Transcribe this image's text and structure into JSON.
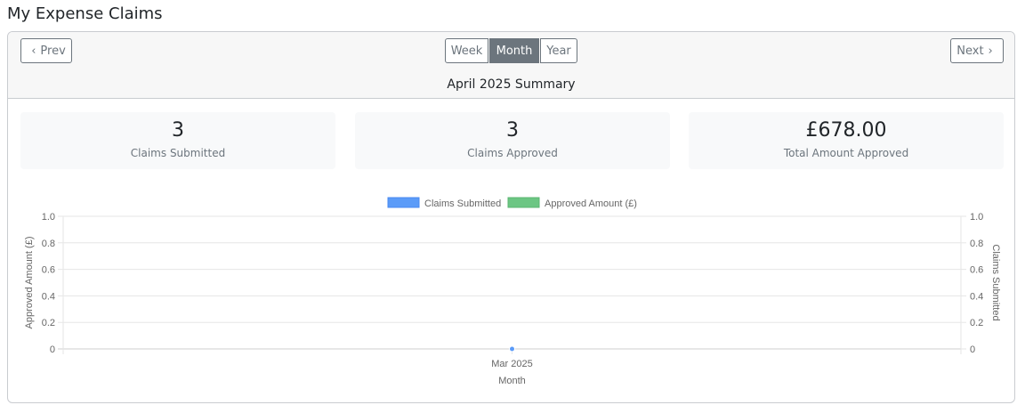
{
  "page": {
    "title": "My Expense Claims"
  },
  "nav": {
    "prev_label": "Prev",
    "next_label": "Next",
    "ranges": [
      "Week",
      "Month",
      "Year"
    ],
    "selected_range": "Month"
  },
  "summary": {
    "title": "April 2025 Summary",
    "stats": [
      {
        "value": "3",
        "label": "Claims Submitted"
      },
      {
        "value": "3",
        "label": "Claims Approved"
      },
      {
        "value": "£678.00",
        "label": "Total Amount Approved"
      }
    ]
  },
  "colors": {
    "claims_submitted": "#5b9bf8",
    "approved_amount": "#6cc683",
    "active_button": "#6c757d"
  },
  "chart_data": {
    "type": "line",
    "x": [
      "Mar 2025"
    ],
    "xlabel": "Month",
    "series": [
      {
        "name": "Claims Submitted",
        "values": [
          0
        ],
        "axis": "right",
        "color": "#5b9bf8"
      },
      {
        "name": "Approved Amount (£)",
        "values": [
          0
        ],
        "axis": "left",
        "color": "#6cc683"
      }
    ],
    "y_left": {
      "label": "Approved Amount (£)",
      "ylim": [
        0,
        1
      ],
      "ticks": [
        "0",
        "0.2",
        "0.4",
        "0.6",
        "0.8",
        "1.0"
      ]
    },
    "y_right": {
      "label": "Claims Submitted",
      "ylim": [
        0,
        1
      ],
      "ticks": [
        "0",
        "0.2",
        "0.4",
        "0.6",
        "0.8",
        "1.0"
      ]
    },
    "legend_position": "top",
    "grid": true
  }
}
